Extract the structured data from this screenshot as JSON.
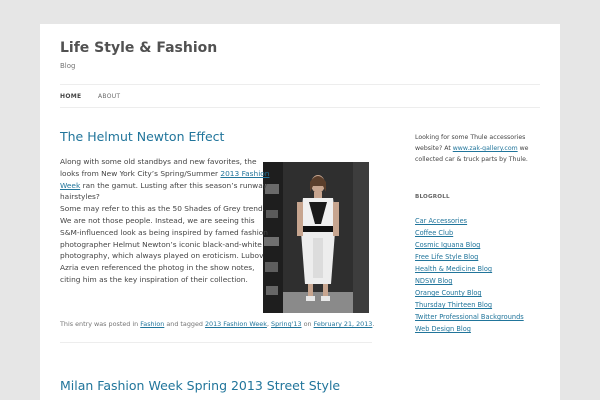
{
  "site": {
    "title": "Life Style & Fashion",
    "description": "Blog"
  },
  "nav": {
    "items": [
      {
        "label": "HOME"
      },
      {
        "label": "ABOUT"
      }
    ]
  },
  "post1": {
    "title": "The Helmut Newton Effect",
    "p1_pre": "Along with some old standbys and new favorites, the looks from New York City’s Spring/Summer ",
    "p1_link": "2013 Fashion Week",
    "p1_post": " ran the gamut. Lusting after this season’s runway hairstyles?",
    "p2": "Some may refer to this as the 50 Shades of Grey trend. We are not those people. Instead, we are seeing this S&M-influenced look as being inspired by famed fashion photographer Helmut Newton’s iconic black-and-white photography, which always played on eroticism. Lubov Azria even referenced the photog in the show notes, citing him as the key inspiration of their collection.",
    "meta": {
      "posted_in": "This entry was posted in ",
      "category": "Fashion",
      "tagged": " and tagged ",
      "tag1": "2013 Fashion Week",
      "sep": ", ",
      "tag2": "Spring'13",
      "on": " on ",
      "date": "February 21, 2013",
      "end": "."
    }
  },
  "post2": {
    "title": "Milan Fashion Week Spring 2013 Street Style"
  },
  "sidebar": {
    "text_pre": "Looking for some Thule accessories website? At ",
    "text_link": "www.zak-gallery.com",
    "text_post": " we collected car & truck parts by Thule.",
    "blogroll_title": "BLOGROLL",
    "blogroll": [
      {
        "label": "Car Accessories"
      },
      {
        "label": "Coffee Club"
      },
      {
        "label": "Cosmic Iguana Blog"
      },
      {
        "label": "Free Life Style Blog"
      },
      {
        "label": "Health & Medicine Blog"
      },
      {
        "label": "NDSW Blog"
      },
      {
        "label": "Orange County Blog"
      },
      {
        "label": "Thursday Thirteen Blog"
      },
      {
        "label": "Twitter Professional Backgrounds"
      },
      {
        "label": "Web Design Blog"
      }
    ]
  }
}
